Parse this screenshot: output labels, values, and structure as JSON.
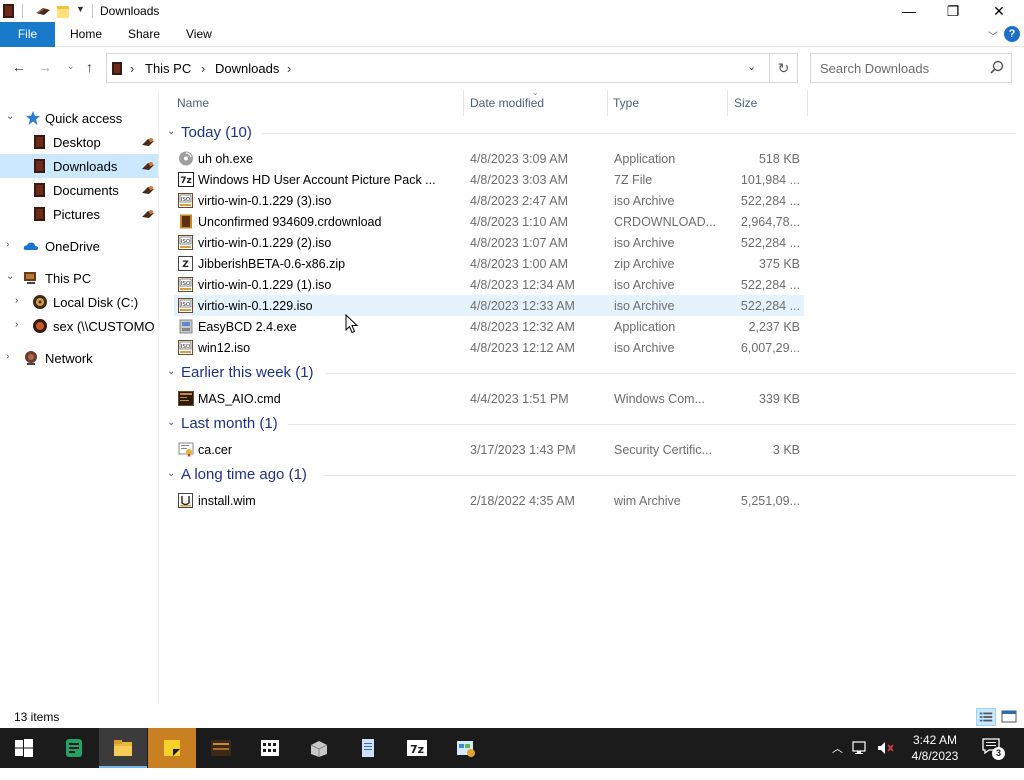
{
  "window": {
    "title": "Downloads",
    "controls": {
      "minimize": "—",
      "maximize": "❐",
      "close": "✕"
    }
  },
  "ribbon": {
    "tabs": [
      "File",
      "Home",
      "Share",
      "View"
    ],
    "help": "?"
  },
  "address": {
    "crumbs": [
      "This PC",
      "Downloads"
    ],
    "search_placeholder": "Search Downloads"
  },
  "nav": {
    "items": [
      {
        "label": "Quick access",
        "icon": "star-icon"
      },
      {
        "label": "Desktop",
        "icon": "folder-icon",
        "pinned": true
      },
      {
        "label": "Downloads",
        "icon": "folder-icon",
        "pinned": true,
        "selected": true
      },
      {
        "label": "Documents",
        "icon": "folder-icon",
        "pinned": true
      },
      {
        "label": "Pictures",
        "icon": "folder-icon",
        "pinned": true
      },
      {
        "label": "OneDrive",
        "icon": "cloud-icon"
      },
      {
        "label": "This PC",
        "icon": "computer-icon"
      },
      {
        "label": "Local Disk (C:)",
        "icon": "drive-icon"
      },
      {
        "label": "sex (\\\\CUSTOMO",
        "icon": "network-drive-icon"
      },
      {
        "label": "Network",
        "icon": "network-icon"
      }
    ]
  },
  "columns": {
    "name": "Name",
    "date": "Date modified",
    "type": "Type",
    "size": "Size"
  },
  "groups": [
    {
      "title": "Today (10)",
      "files": [
        {
          "name": "uh oh.exe",
          "date": "4/8/2023 3:09 AM",
          "type": "Application",
          "size": "518 KB",
          "icon": "disc-icon"
        },
        {
          "name": "Windows HD User Account Picture Pack ...",
          "date": "4/8/2023 3:03 AM",
          "type": "7Z File",
          "size": "101,984 ...",
          "icon": "7z-icon"
        },
        {
          "name": "virtio-win-0.1.229 (3).iso",
          "date": "4/8/2023 2:47 AM",
          "type": "iso Archive",
          "size": "522,284 ...",
          "icon": "iso-icon"
        },
        {
          "name": "Unconfirmed 934609.crdownload",
          "date": "4/8/2023 1:10 AM",
          "type": "CRDOWNLOAD...",
          "size": "2,964,78...",
          "icon": "file-icon"
        },
        {
          "name": "virtio-win-0.1.229 (2).iso",
          "date": "4/8/2023 1:07 AM",
          "type": "iso Archive",
          "size": "522,284 ...",
          "icon": "iso-icon"
        },
        {
          "name": "JibberishBETA-0.6-x86.zip",
          "date": "4/8/2023 1:00 AM",
          "type": "zip Archive",
          "size": "375 KB",
          "icon": "zip-icon"
        },
        {
          "name": "virtio-win-0.1.229 (1).iso",
          "date": "4/8/2023 12:34 AM",
          "type": "iso Archive",
          "size": "522,284 ...",
          "icon": "iso-icon"
        },
        {
          "name": "virtio-win-0.1.229.iso",
          "date": "4/8/2023 12:33 AM",
          "type": "iso Archive",
          "size": "522,284 ...",
          "icon": "iso-icon",
          "hover": true
        },
        {
          "name": "EasyBCD 2.4.exe",
          "date": "4/8/2023 12:32 AM",
          "type": "Application",
          "size": "2,237 KB",
          "icon": "app-icon"
        },
        {
          "name": "win12.iso",
          "date": "4/8/2023 12:12 AM",
          "type": "iso Archive",
          "size": "6,007,29...",
          "icon": "iso-icon"
        }
      ]
    },
    {
      "title": "Earlier this week (1)",
      "files": [
        {
          "name": "MAS_AIO.cmd",
          "date": "4/4/2023 1:51 PM",
          "type": "Windows Com...",
          "size": "339 KB",
          "icon": "cmd-icon"
        }
      ]
    },
    {
      "title": "Last month (1)",
      "files": [
        {
          "name": "ca.cer",
          "date": "3/17/2023 1:43 PM",
          "type": "Security Certific...",
          "size": "3 KB",
          "icon": "certificate-icon"
        }
      ]
    },
    {
      "title": "A long time ago (1)",
      "files": [
        {
          "name": "install.wim",
          "date": "2/18/2022 4:35 AM",
          "type": "wim Archive",
          "size": "5,251,09...",
          "icon": "wim-icon"
        }
      ]
    }
  ],
  "status": {
    "items": "13 items"
  },
  "taskbar": {
    "apps": [
      "start-icon",
      "sheets-icon",
      "file-explorer-icon",
      "sticky-notes-icon",
      "game-icon",
      "calculator-icon",
      "installer-icon",
      "notepad-icon",
      "7zip-icon",
      "control-panel-icon"
    ],
    "time": "3:42 AM",
    "date": "4/8/2023",
    "notifications": "3"
  }
}
